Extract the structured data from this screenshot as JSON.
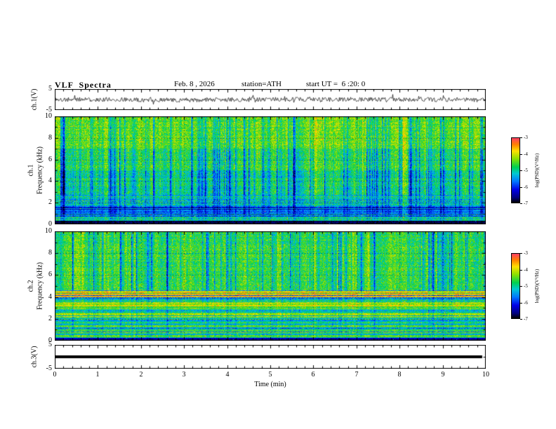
{
  "header": {
    "title": "VLF  Spectra",
    "date": "Feb. 8 , 2026",
    "station": "station=ATH",
    "start_ut": "start UT =  6 :20: 0"
  },
  "x_axis": {
    "label": "Time (min)",
    "min": 0,
    "max": 10,
    "ticks": [
      0,
      1,
      2,
      3,
      4,
      5,
      6,
      7,
      8,
      9,
      10
    ],
    "tick_labels": [
      "0",
      "1",
      "2",
      "3",
      "4",
      "5",
      "6",
      "7",
      "8",
      "9",
      "10"
    ]
  },
  "colorbar": {
    "label": "log(PSD)(V²/Hz)",
    "max": -3,
    "min": -7,
    "tick_labels": [
      "-3",
      "-4",
      "-5",
      "-6",
      "-7"
    ],
    "stops": [
      {
        "t": 0.0,
        "c": "#000000"
      },
      {
        "t": 0.08,
        "c": "#000082"
      },
      {
        "t": 0.2,
        "c": "#0000e6"
      },
      {
        "t": 0.33,
        "c": "#0078ff"
      },
      {
        "t": 0.45,
        "c": "#00c8d2"
      },
      {
        "t": 0.55,
        "c": "#00d050"
      },
      {
        "t": 0.68,
        "c": "#8ce000"
      },
      {
        "t": 0.8,
        "c": "#ffe000"
      },
      {
        "t": 0.9,
        "c": "#ff8000"
      },
      {
        "t": 1.0,
        "c": "#ff4064"
      }
    ]
  },
  "chart_data": [
    {
      "type": "line",
      "name": "ch1_waveform",
      "ylabel": "ch.1(V)",
      "ylim": [
        -5,
        5
      ],
      "yticks": [
        5,
        -5
      ],
      "ytick_labels": [
        "5",
        "-5"
      ],
      "yticks_minor": [
        0
      ],
      "xlim": [
        0,
        10
      ],
      "description": "Broadband noisy VLF channel-1 voltage trace, mean 0 V, typical excursions ±1 V with sferic spikes to ±3 V",
      "signal": {
        "seed": 11,
        "base_amp_V": 1.0,
        "spike_prob": 0.04,
        "spike_amp_V": 2.5,
        "mean_V": 0
      }
    },
    {
      "type": "heatmap",
      "name": "ch1_spectrogram",
      "ylabel_lines": [
        "ch.1",
        "Frequency (kHz)"
      ],
      "ylim": [
        0,
        10
      ],
      "yticks": [
        0,
        2,
        4,
        6,
        8,
        10
      ],
      "ytick_labels": [
        "0",
        "2",
        "4",
        "6",
        "8",
        "10"
      ],
      "yticks_minor": [
        1,
        3,
        5,
        7,
        9
      ],
      "xlim": [
        0,
        10
      ],
      "value_range_log_psd": [
        -7,
        -3
      ],
      "description": "VLF spectrogram ch.1: green/yellow background, dense dark-blue vertical sferic streaks 2.5-7 kHz, blue/cyan horizontal banding below 2.5 kHz, near-black band at 0-0.3 kHz, scattered red specks",
      "noise": {
        "seed": 101,
        "bright_prob": 0.004,
        "columns": {
          "deep_prob": 0.1,
          "mod_prob": 0.22,
          "bright_prob": 0.02
        },
        "bands": [
          {
            "f0": 0.0,
            "f1": 0.35,
            "base": 0.05,
            "noise": 0.04,
            "colmod": 0.05,
            "rownoise": 0.04
          },
          {
            "f0": 0.35,
            "f1": 0.9,
            "base": 0.38,
            "noise": 0.1,
            "colmod": 0.15,
            "rownoise": 0.22
          },
          {
            "f0": 0.9,
            "f1": 1.6,
            "base": 0.3,
            "noise": 0.1,
            "colmod": 0.2,
            "rownoise": 0.15
          },
          {
            "f0": 1.6,
            "f1": 2.7,
            "base": 0.48,
            "noise": 0.12,
            "colmod": 0.25,
            "rownoise": 0.1
          },
          {
            "f0": 2.7,
            "f1": 5.0,
            "base": 0.55,
            "noise": 0.12,
            "colmod": 0.42,
            "rownoise": 0.04
          },
          {
            "f0": 5.0,
            "f1": 7.0,
            "base": 0.6,
            "noise": 0.12,
            "colmod": 0.38,
            "rownoise": 0.03
          },
          {
            "f0": 7.0,
            "f1": 10.0,
            "base": 0.66,
            "noise": 0.12,
            "colmod": 0.3,
            "rownoise": 0.03
          }
        ]
      }
    },
    {
      "type": "heatmap",
      "name": "ch2_spectrogram",
      "ylabel_lines": [
        "ch.2",
        "Frequency (kHz)"
      ],
      "ylim": [
        0,
        10
      ],
      "yticks": [
        0,
        2,
        4,
        6,
        8,
        10
      ],
      "ytick_labels": [
        "0",
        "2",
        "4",
        "6",
        "8",
        "10"
      ],
      "yticks_minor": [
        1,
        3,
        5,
        7,
        9
      ],
      "xlim": [
        0,
        10
      ],
      "value_range_log_psd": [
        -7,
        -3
      ],
      "description": "VLF spectrogram ch.2: green/cyan background, blue vertical sferic streaks above 5 kHz, yellow-orange band near 3-3.5 kHz, orange/red horizontal lines 3.5-4.6 kHz, fine horizontal striping below 3 kHz",
      "noise": {
        "seed": 202,
        "bright_prob": 0.004,
        "columns": {
          "deep_prob": 0.08,
          "mod_prob": 0.2,
          "bright_prob": 0.02
        },
        "bands": [
          {
            "f0": 0.0,
            "f1": 0.25,
            "base": 0.12,
            "noise": 0.05,
            "colmod": 0.05,
            "rownoise": 0.05
          },
          {
            "f0": 0.25,
            "f1": 1.2,
            "base": 0.5,
            "noise": 0.1,
            "colmod": 0.1,
            "rownoise": 0.2
          },
          {
            "f0": 1.2,
            "f1": 2.9,
            "base": 0.55,
            "noise": 0.1,
            "colmod": 0.12,
            "rownoise": 0.18
          },
          {
            "f0": 2.9,
            "f1": 3.5,
            "base": 0.7,
            "noise": 0.1,
            "colmod": 0.1,
            "rownoise": 0.15
          },
          {
            "f0": 3.5,
            "f1": 4.6,
            "base": 0.58,
            "noise": 0.1,
            "colmod": 0.15,
            "rownoise": 0.32
          },
          {
            "f0": 4.6,
            "f1": 10.0,
            "base": 0.6,
            "noise": 0.12,
            "colmod": 0.34,
            "rownoise": 0.04
          }
        ]
      }
    },
    {
      "type": "line",
      "name": "ch3_waveform",
      "ylabel": "ch.3(V)",
      "ylim": [
        -5,
        5
      ],
      "yticks": [
        5,
        -5
      ],
      "ytick_labels": [
        "5",
        "-5"
      ],
      "yticks_minor": [
        0
      ],
      "xlim": [
        0,
        10
      ],
      "description": "Channel-3 voltage: flat thick black line at 0 V for the whole record",
      "signal": {
        "constant_V": 0,
        "line_thickness_px": 4,
        "end_frac": 0.99
      }
    }
  ]
}
